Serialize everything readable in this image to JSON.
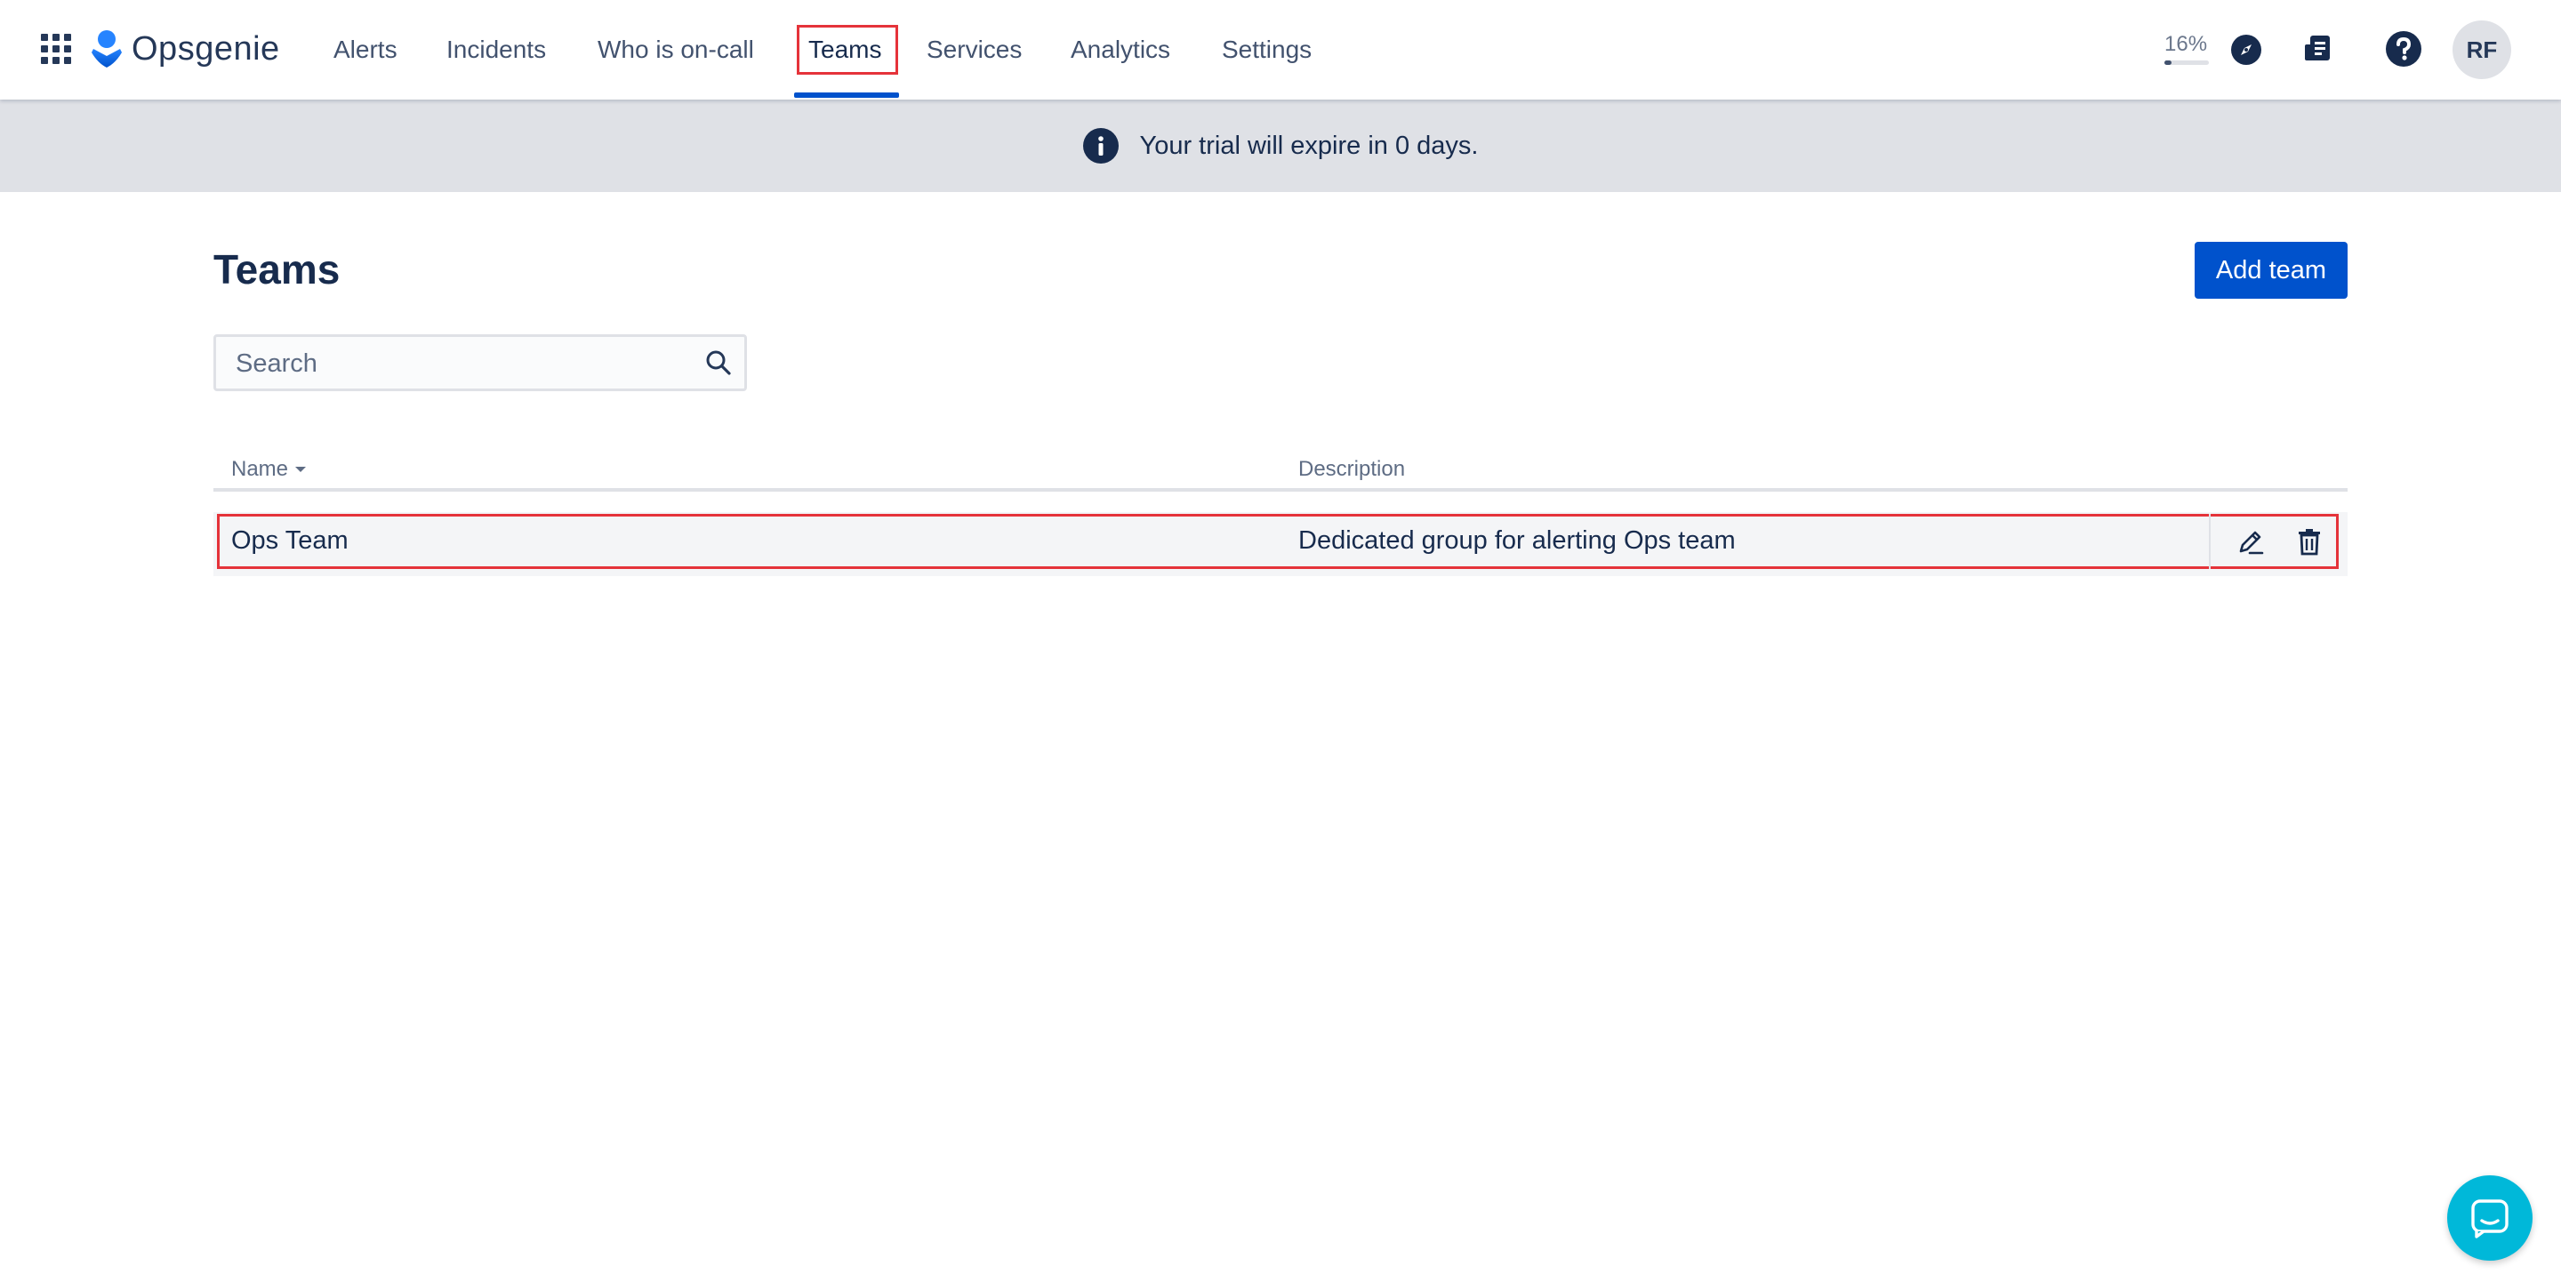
{
  "app": {
    "name": "Opsgenie",
    "brand_color": "#0052cc"
  },
  "nav": {
    "items": [
      {
        "label": "Alerts"
      },
      {
        "label": "Incidents"
      },
      {
        "label": "Who is on-call"
      },
      {
        "label": "Teams",
        "active": true
      },
      {
        "label": "Services"
      },
      {
        "label": "Analytics"
      },
      {
        "label": "Settings"
      }
    ],
    "progress_label": "16%",
    "progress_value": 0.16,
    "icons": [
      "compass-icon",
      "whats-new-icon",
      "help-icon"
    ],
    "avatar_initials": "RF"
  },
  "banner": {
    "icon": "info-icon",
    "text": "Your trial will expire in 0 days."
  },
  "page": {
    "title": "Teams",
    "add_button": "Add team",
    "search_placeholder": "Search"
  },
  "table": {
    "columns": [
      "Name",
      "Description"
    ],
    "sort_indicator": "caret-down-icon",
    "rows": [
      {
        "name": "Ops Team",
        "description": "Dedicated group for alerting Ops team"
      }
    ]
  },
  "chat_widget": {
    "icon": "chat-icon",
    "color": "#00b8d9"
  }
}
